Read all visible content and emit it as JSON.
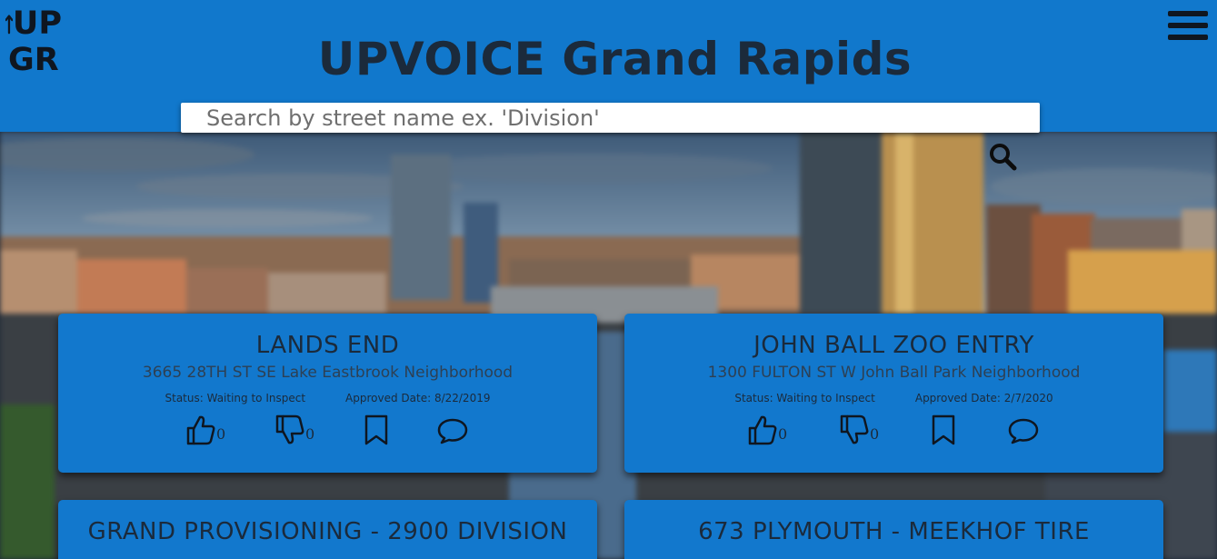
{
  "header": {
    "logo_line1": "UP",
    "logo_line2": "GR",
    "title": "UPVOICE Grand Rapids"
  },
  "search": {
    "placeholder": "Search by street name ex. 'Division'"
  },
  "icons": {
    "logo": "up-arrow-icon",
    "menu": "hamburger-menu-icon",
    "search": "magnifier-icon",
    "like": "thumbs-up-icon",
    "dislike": "thumbs-down-icon",
    "save": "bookmark-icon",
    "comment": "speech-bubble-icon"
  },
  "colors": {
    "header": "#1178cc",
    "card": "#1278cd",
    "text": "#1b2a3b"
  },
  "cards": [
    {
      "title": "LANDS END",
      "address": "3665 28TH ST SE Lake Eastbrook Neighborhood",
      "status": "Status: Waiting to Inspect",
      "approved": "Approved Date: 8/22/2019",
      "likes": "0",
      "dislikes": "0"
    },
    {
      "title": "JOHN BALL ZOO ENTRY",
      "address": "1300 FULTON ST W John Ball Park Neighborhood",
      "status": "Status: Waiting to Inspect",
      "approved": "Approved Date: 2/7/2020",
      "likes": "0",
      "dislikes": "0"
    },
    {
      "title": "GRAND PROVISIONING - 2900 DIVISION"
    },
    {
      "title": "673 PLYMOUTH - MEEKHOF TIRE"
    }
  ]
}
